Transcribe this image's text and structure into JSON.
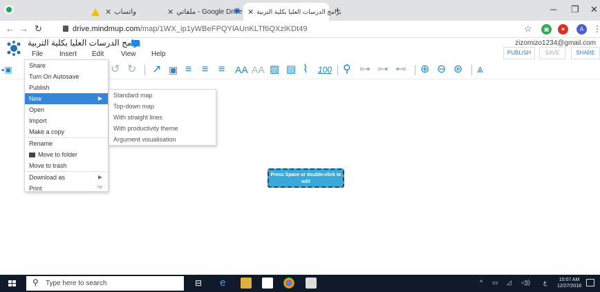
{
  "browser": {
    "tabs": [
      {
        "title": "واتساب"
      },
      {
        "title": "ملفاتي - Google Drive"
      },
      {
        "title": "برامج الدرسات العليا بكلية التربية"
      }
    ],
    "url_host": "drive.mindmup.com",
    "url_path": "/map/1WX_ip1yWBeFPQYlAUnKLTf6QXzlKDt49",
    "new_tab": "+"
  },
  "app": {
    "map_title": "برامج الدرسات العليا بكلية التربية",
    "menubar": [
      "File",
      "Insert",
      "Edit",
      "View",
      "Help"
    ],
    "user_email": "zizomizo1234@gmail.com",
    "publish_label": "PUBLISH",
    "save_label": "SAVE",
    "share_label": "SHARE"
  },
  "file_menu": {
    "items": [
      {
        "label": "Share"
      },
      {
        "label": "Turn On Autosave"
      },
      {
        "label": "Publish"
      },
      {
        "label": "New",
        "active": true,
        "has_submenu": true
      },
      {
        "label": "Open"
      },
      {
        "label": "Import"
      },
      {
        "label": "Make a copy"
      },
      {
        "label": "Rename"
      },
      {
        "label": "Move to folder",
        "icon": "folder-icon"
      },
      {
        "label": "Move to trash"
      },
      {
        "label": "Download as",
        "has_submenu": true
      },
      {
        "label": "Print",
        "shortcut": "^P"
      }
    ]
  },
  "new_submenu": {
    "items": [
      {
        "label": "Standard map"
      },
      {
        "label": "Top-down map"
      },
      {
        "label": "With straight lines"
      },
      {
        "label": "With productivity theme"
      },
      {
        "label": "Argument visualisation"
      }
    ]
  },
  "canvas": {
    "node_text": "Press Space or double-click to edit"
  },
  "taskbar": {
    "search_placeholder": "Type here to search",
    "time": "10:07 AM",
    "date": "12/27/2018",
    "lang": "ع"
  },
  "colors": {
    "accent": "#3586d9",
    "node_fill": "#39a9dc",
    "taskbar": "#101a2a"
  }
}
